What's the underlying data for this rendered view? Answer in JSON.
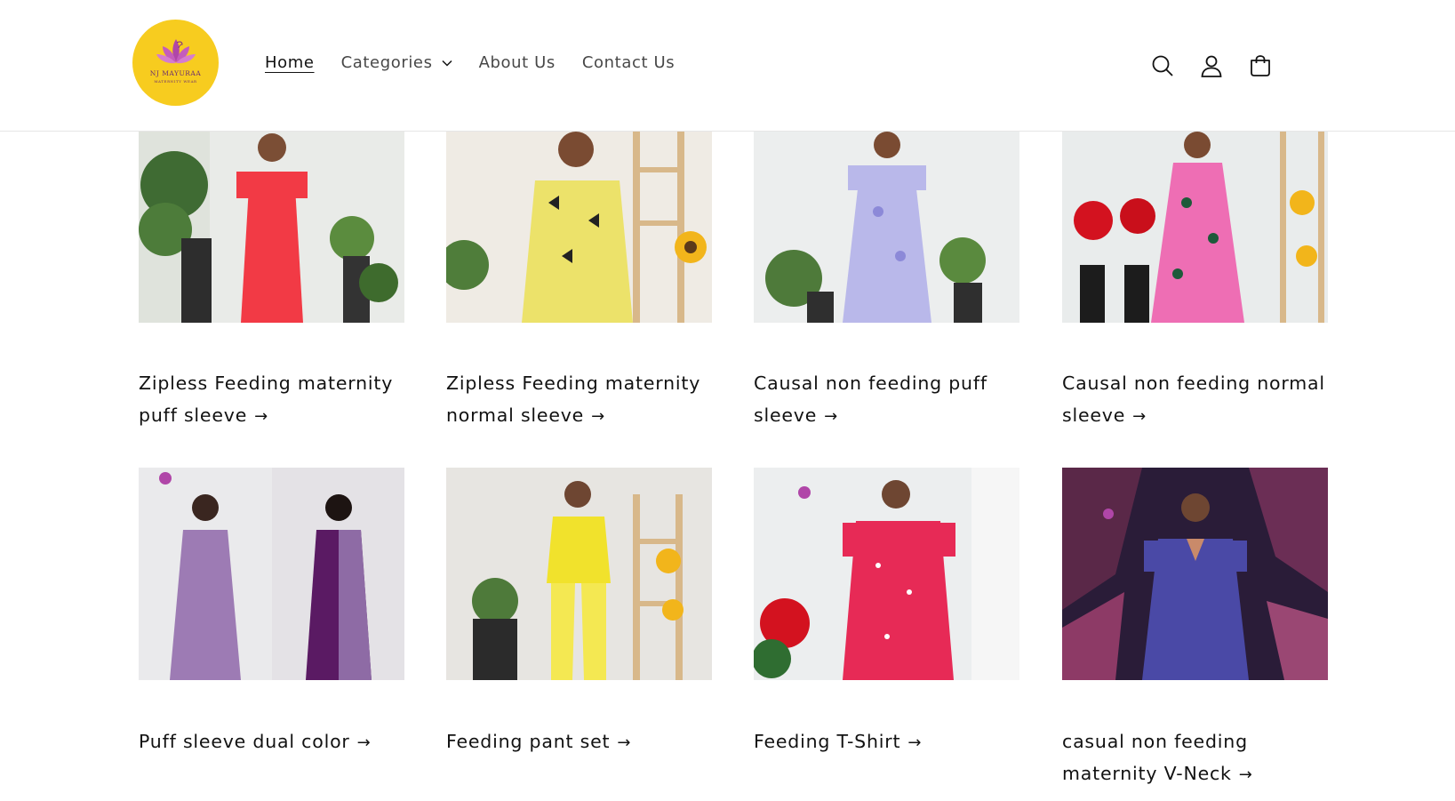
{
  "brand": {
    "name": "NJ MAYURAA",
    "tagline": "MATERNITY WEAR",
    "colors": {
      "logo_bg": "#f7cc1f",
      "logo_mark": "#b046a8"
    }
  },
  "nav": {
    "items": [
      {
        "label": "Home",
        "active": true
      },
      {
        "label": "Categories",
        "has_dropdown": true
      },
      {
        "label": "About Us"
      },
      {
        "label": "Contact Us"
      }
    ]
  },
  "header_icons": [
    "search-icon",
    "account-icon",
    "cart-icon"
  ],
  "collections": [
    {
      "title": "Zipless Feeding maternity puff sleeve",
      "bg": "#e9ebe8",
      "dress": "#f23a45"
    },
    {
      "title": "Zipless Feeding maternity normal sleeve",
      "bg": "#efebe4",
      "dress": "#ece26a"
    },
    {
      "title": "Causal non feeding puff sleeve",
      "bg": "#eceeee",
      "dress": "#b9b8ea"
    },
    {
      "title": "Causal non feeding normal sleeve",
      "bg": "#e9ecec",
      "dress": "#ee6eb4"
    },
    {
      "title": "Puff sleeve dual color",
      "bg": "#eaeaec",
      "dress": "#9d7bb4"
    },
    {
      "title": "Feeding pant set",
      "bg": "#e7e5e1",
      "dress": "#f1e22c"
    },
    {
      "title": "Feeding T-Shirt",
      "bg": "#eceeef",
      "dress": "#e72a56"
    },
    {
      "title": "casual non feeding maternity V-Neck",
      "bg": "#2a1c38",
      "dress": "#4a49a6"
    }
  ]
}
